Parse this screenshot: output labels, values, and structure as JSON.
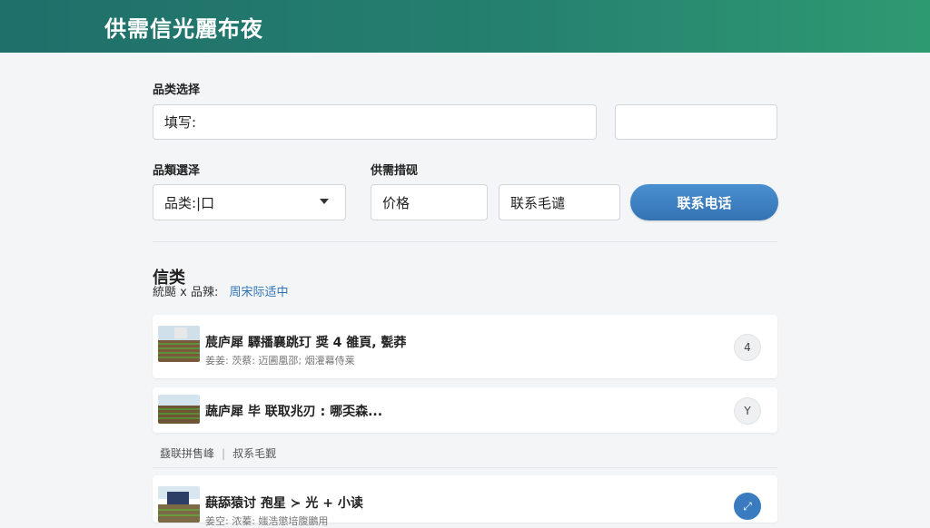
{
  "header": {
    "title": "供需信光麗布夜"
  },
  "form": {
    "category_label": "品类选择",
    "category_input": "填写:",
    "category_extra": "",
    "variety_label": "品類選泽",
    "variety_select": "品类:|口",
    "supply_label": "供需措砚",
    "price_field": "价格",
    "phone_field": "联系毛谴",
    "contact_button": "联系电话"
  },
  "list": {
    "title": "信类",
    "filter_prefix": "統颳 x 品辣:",
    "filter_link": "周宋际适中",
    "items": [
      {
        "title": "莀庐犀 驛播襄跳玎 奨 4 雒頁, 甏莽",
        "meta": "姜姜: 茨蔡: 迈圃凰邵; 烟灌幕侍莱",
        "action": "4",
        "active": false
      },
      {
        "title": "蔬庐犀 毕 联取兆刃 : 哪奀森...",
        "meta": "",
        "action": "Y",
        "active": false
      },
      {
        "title": "蕻舔猿讨 孢星 ≻ 光 + 小读",
        "meta": "姜空: 浓蓁: 媸浩懲培腹鵬用",
        "action": "⤢",
        "active": true
      }
    ],
    "middle_left": "鼗联拼售峰",
    "middle_right": "叔系毛觐"
  }
}
